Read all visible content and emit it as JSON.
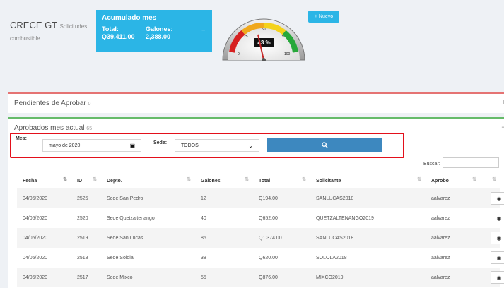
{
  "brand": {
    "title": "CRECE GT",
    "subtitle_part1": "Solicitudes",
    "subtitle_part2": "combustible"
  },
  "summary_card": {
    "title": "Acumulado mes",
    "total_label": "Total:",
    "total_value": "Q39,411.00",
    "galones_label": "Galones:",
    "galones_value": "2,388.00",
    "dash": "–"
  },
  "gauge": {
    "percent_text": "43 %",
    "percent": 43,
    "ticks": [
      "0",
      "25",
      "50",
      "75",
      "100"
    ]
  },
  "new_button": {
    "icon": "plus-icon",
    "label": "Nuevo"
  },
  "sections": {
    "pending": {
      "title": "Pendientes de Aprobar",
      "count": "0",
      "toggle": "+"
    },
    "approved": {
      "title": "Aprobados mes actual",
      "count": "65",
      "toggle": "–"
    }
  },
  "filter": {
    "mes_label": "Mes:",
    "mes_value": "mayo de 2020",
    "sede_label": "Sede:",
    "sede_value": "TODOS",
    "search_icon": "search-icon"
  },
  "search": {
    "label": "Buscar:",
    "value": ""
  },
  "table": {
    "columns": [
      "Fecha",
      "ID",
      "Depto.",
      "Galones",
      "Total",
      "Solicitante",
      "Aprobo",
      ""
    ],
    "rows": [
      [
        "04/05/2020",
        "2525",
        "Sede San Pedro",
        "12",
        "Q194.00",
        "SANLUCAS2018",
        "aalvarez"
      ],
      [
        "04/05/2020",
        "2520",
        "Sede Quetzaltenango",
        "40",
        "Q652.00",
        "QUETZALTENANGO2019",
        "aalvarez"
      ],
      [
        "04/05/2020",
        "2519",
        "Sede San Lucas",
        "85",
        "Q1,374.00",
        "SANLUCAS2018",
        "aalvarez"
      ],
      [
        "04/05/2020",
        "2518",
        "Sede Solola",
        "38",
        "Q620.00",
        "SOLOLA2018",
        "aalvarez"
      ],
      [
        "04/05/2020",
        "2517",
        "Sede Mixco",
        "55",
        "Q876.00",
        "MIXCO2019",
        "aalvarez"
      ]
    ]
  },
  "colors": {
    "accent": "#2bb5e6",
    "search_button": "#3d88bf",
    "highlight": "#e3101b",
    "pending_border": "#e57373",
    "approved_border": "#66bb6a"
  }
}
